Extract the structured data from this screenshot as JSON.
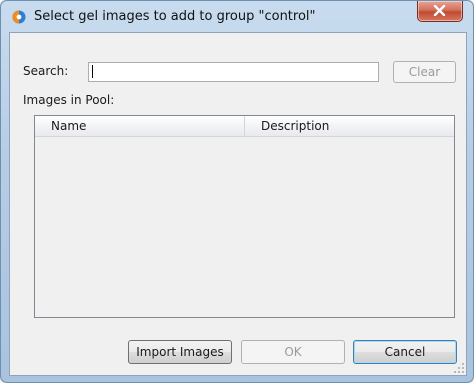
{
  "window": {
    "title": "Select gel images to add to group \"control\"",
    "icon": "app-icon",
    "close_icon": "close-icon"
  },
  "search": {
    "label": "Search:",
    "value": "",
    "clear_label": "Clear"
  },
  "pool": {
    "label": "Images in Pool:",
    "columns": [
      "Name",
      "Description"
    ],
    "rows": []
  },
  "buttons": {
    "import_label": "Import Images",
    "ok_label": "OK",
    "cancel_label": "Cancel"
  },
  "colors": {
    "titlebar": "#b6cde5",
    "close_button": "#c04a33",
    "dialog_body": "#f0f0f0"
  }
}
